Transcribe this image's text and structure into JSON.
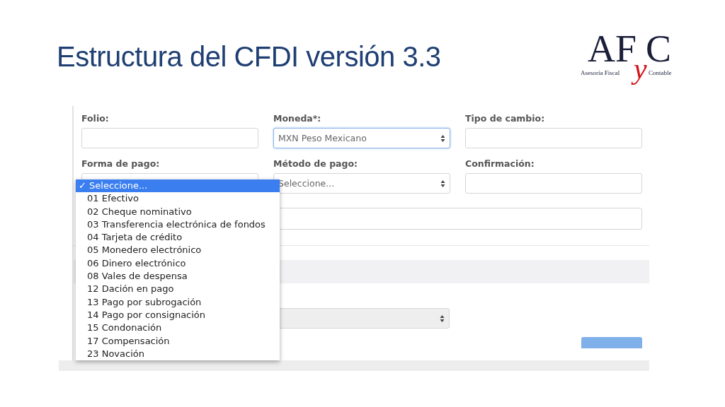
{
  "slide": {
    "title": "Estructura del CFDI versión 3.3"
  },
  "logo": {
    "letters_left": "AF",
    "letter_middle": "y",
    "letter_right": "C",
    "tagline_left": "Asesoría Fiscal",
    "tagline_right": "Contable"
  },
  "form": {
    "rows": [
      [
        {
          "label": "Folio:",
          "kind": "input",
          "focused": false
        },
        {
          "label": "Moneda*:",
          "kind": "select",
          "value": "MXN Peso Mexicano",
          "focused": true
        },
        {
          "label": "Tipo de cambio:",
          "kind": "input",
          "focused": false
        }
      ],
      [
        {
          "label": "Forma de pago:",
          "kind": "select",
          "focused": false
        },
        {
          "label": "Método de pago:",
          "kind": "select",
          "value": "Seleccione...",
          "focused": false
        },
        {
          "label": "Confirmación:",
          "kind": "input",
          "focused": false
        }
      ]
    ],
    "lower_select": {
      "disabled": true
    },
    "dropdown": {
      "check_mark": "✓",
      "options": [
        {
          "label": "Seleccione...",
          "selected": true
        },
        {
          "label": "01 Efectivo",
          "selected": false
        },
        {
          "label": "02 Cheque nominativo",
          "selected": false
        },
        {
          "label": "03 Transferencia electrónica de fondos",
          "selected": false
        },
        {
          "label": "04 Tarjeta de crédito",
          "selected": false
        },
        {
          "label": "05 Monedero electrónico",
          "selected": false
        },
        {
          "label": "06 Dinero electrónico",
          "selected": false
        },
        {
          "label": "08 Vales de despensa",
          "selected": false
        },
        {
          "label": "12 Dación en pago",
          "selected": false
        },
        {
          "label": "13 Pago por subrogación",
          "selected": false
        },
        {
          "label": "14 Pago por consignación",
          "selected": false
        },
        {
          "label": "15 Condonación",
          "selected": false
        },
        {
          "label": "17 Compensación",
          "selected": false
        },
        {
          "label": "23 Novación",
          "selected": false
        }
      ]
    }
  }
}
